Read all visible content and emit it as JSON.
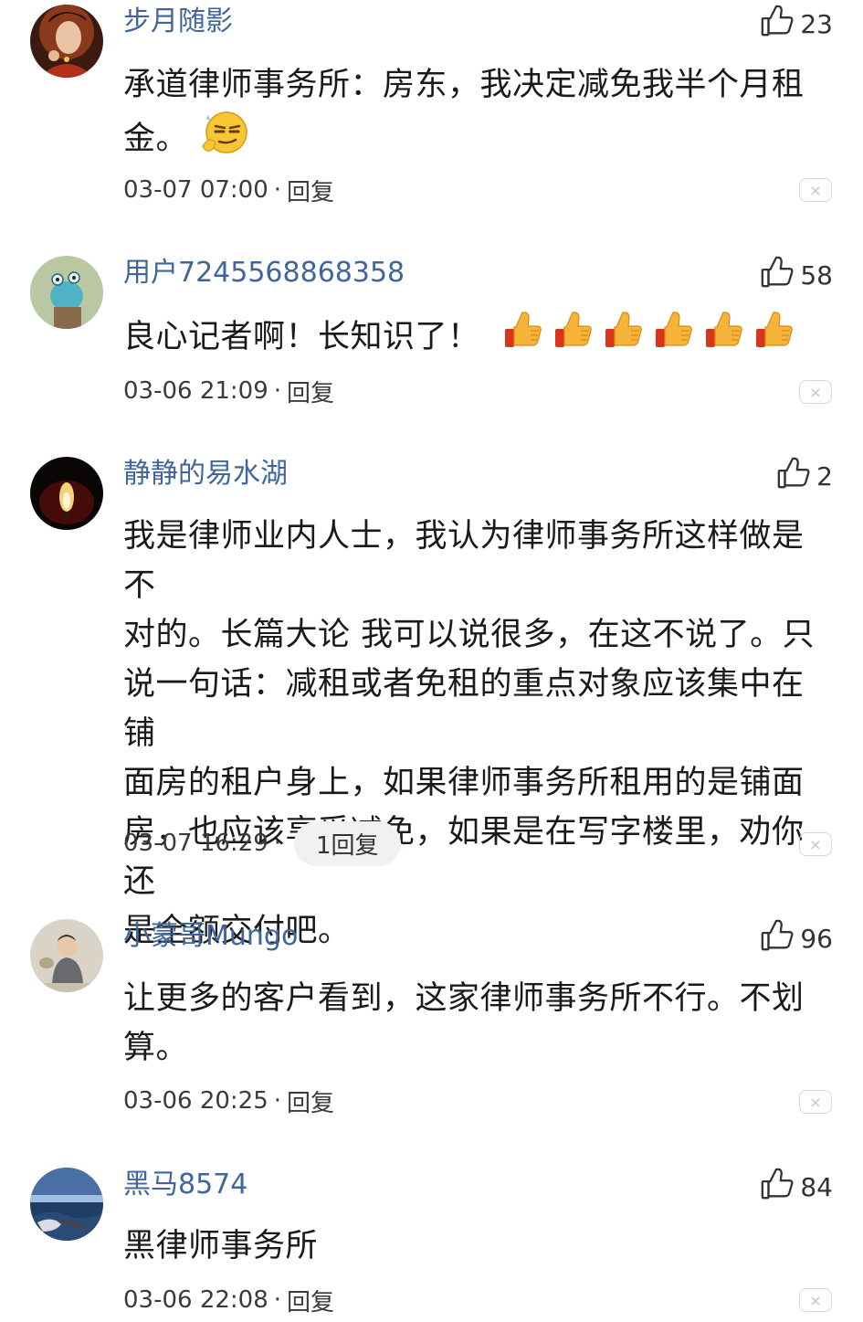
{
  "comments": [
    {
      "username": "步月随影",
      "likes": "23",
      "text_line1": "承道律师事务所：房东，我决定减免我半个月租",
      "text_line2": "金。",
      "emoji": "thinking-smirk-emoji",
      "time": "03-07 07:00",
      "reply_label": "回复"
    },
    {
      "username": "用户7245568868358",
      "likes": "58",
      "text": "良心记者啊！长知识了！",
      "emoji": "thumbs-up-emoji",
      "emoji_count": 6,
      "time": "03-06 21:09",
      "reply_label": "回复"
    },
    {
      "username": "静静的易水湖",
      "likes": "2",
      "lines": [
        "我是律师业内人士，我认为律师事务所这样做是不",
        "对的。长篇大论 我可以说很多，在这不说了。只",
        "说一句话：减租或者免租的重点对象应该集中在铺",
        "面房的租户身上，如果律师事务所租用的是铺面",
        "房，也应该享受减免，如果是在写字楼里，劝你还",
        "是全额交付吧。"
      ],
      "time": "03-07 16:29",
      "reply_label": "1回复"
    },
    {
      "username": "小蒙哥Mungo",
      "likes": "96",
      "text_line1": "让更多的客户看到，这家律师事务所不行。不划",
      "text_line2": "算。",
      "time": "03-06 20:25",
      "reply_label": "回复"
    },
    {
      "username": "黑马8574",
      "likes": "84",
      "text": "黑律师事务所",
      "time": "03-06 22:08",
      "reply_label": "回复"
    }
  ],
  "icons": {
    "like": "thumbs-up-outline-icon",
    "close": "close-icon"
  },
  "colors": {
    "username": "#40659a",
    "text": "#1a1a1a",
    "meta": "#3a3a3a",
    "pill_bg": "#f0f1f3"
  },
  "separator": "·",
  "close_glyph": "×"
}
